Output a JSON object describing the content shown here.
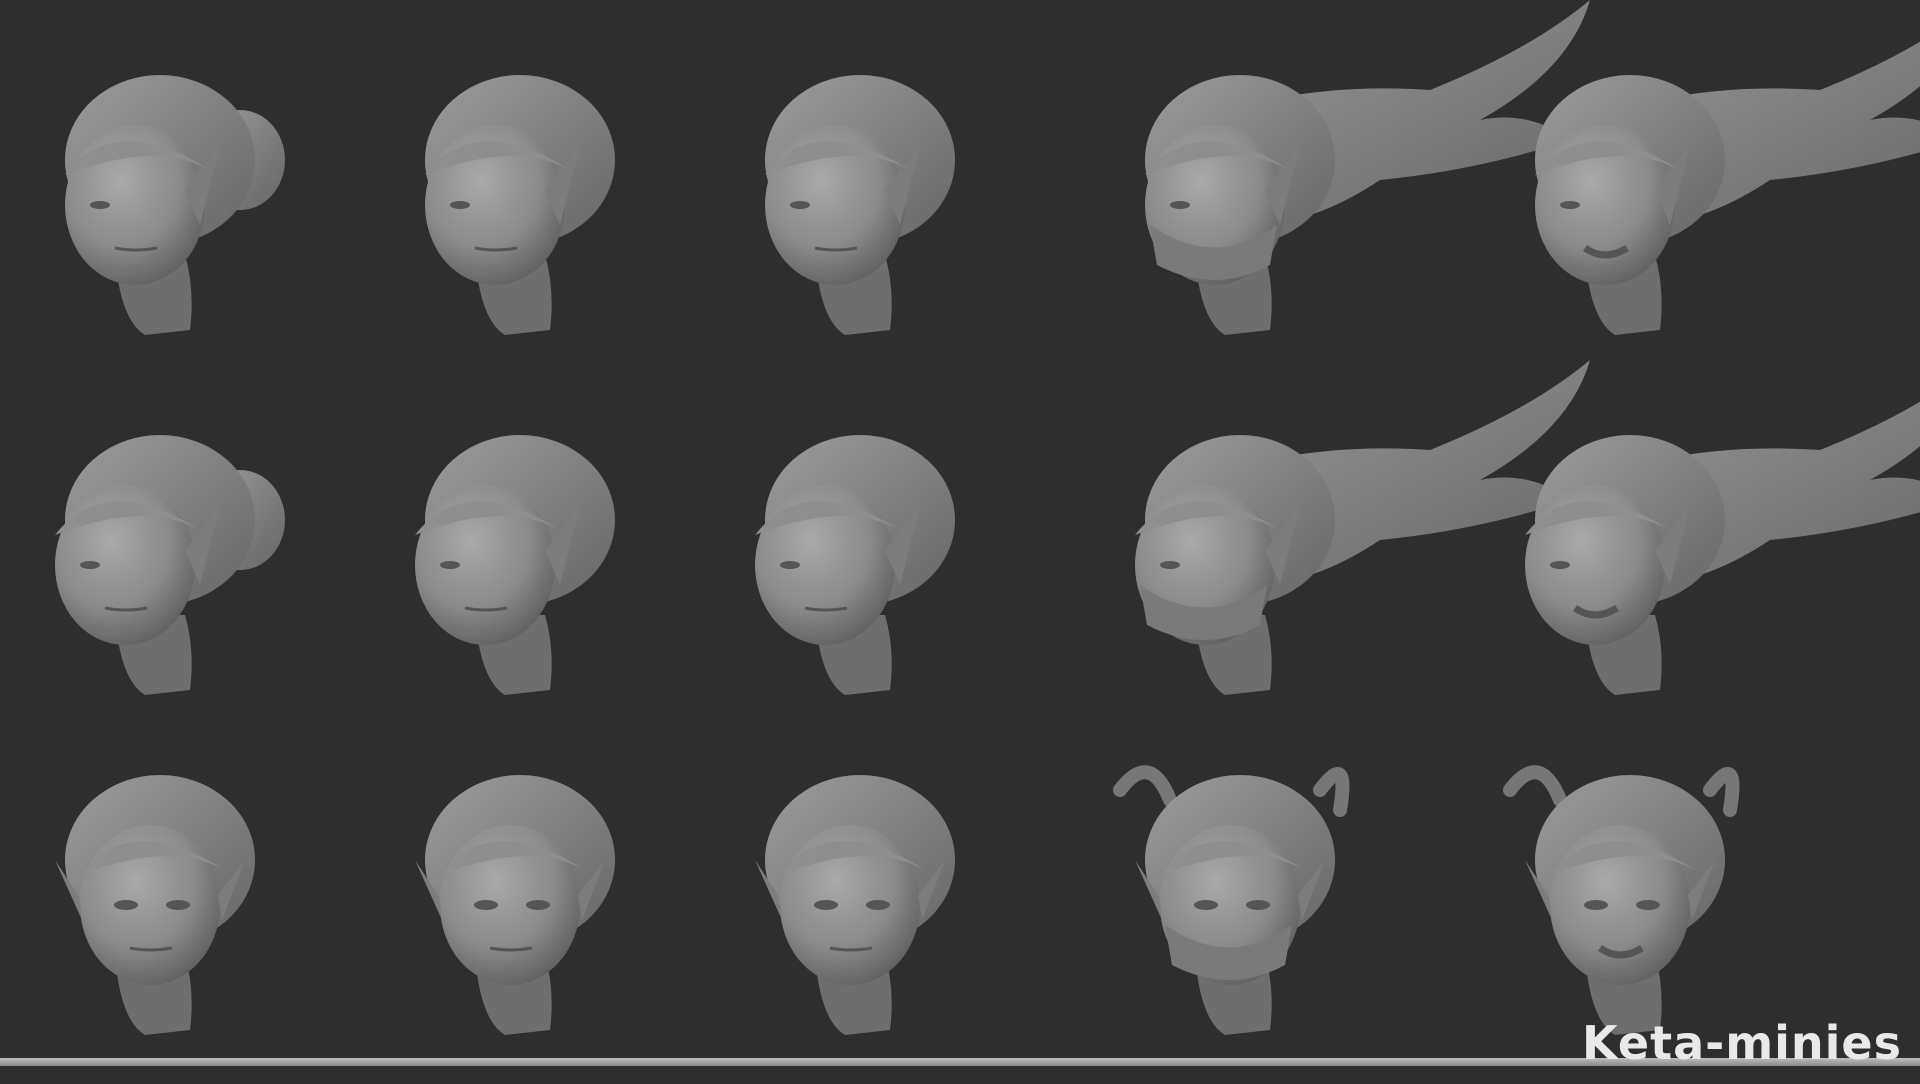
{
  "title": "",
  "brand": {
    "text": "Keta-minies"
  },
  "palette": {
    "background": "#2e2e2e",
    "sculpt_fill": "#8b8b8b",
    "sculpt_light": "#a6a6a6",
    "sculpt_dark": "#5b5b5b",
    "rule": "#a9a9a9",
    "brand_color": "#e9e9e9"
  },
  "heads": [
    {
      "id": "bun-three-quarter",
      "style": "low bun",
      "view": "three-quarter"
    },
    {
      "id": "braid-three-quarter",
      "style": "crown braid",
      "view": "three-quarter"
    },
    {
      "id": "bob-three-quarter",
      "style": "side-swept bob",
      "view": "three-quarter"
    },
    {
      "id": "windswept-masked-three-quarter",
      "style": "windswept long hair with mask",
      "view": "three-quarter"
    },
    {
      "id": "windswept-snarl-three-quarter",
      "style": "windswept long hair, snarling",
      "view": "three-quarter"
    },
    {
      "id": "bun-profile",
      "style": "low bun",
      "view": "profile"
    },
    {
      "id": "braid-profile",
      "style": "crown braid",
      "view": "profile"
    },
    {
      "id": "bob-profile",
      "style": "side-swept bob",
      "view": "profile"
    },
    {
      "id": "windswept-masked-profile",
      "style": "windswept long hair with mask",
      "view": "profile"
    },
    {
      "id": "windswept-snarl-profile",
      "style": "windswept long hair, snarling",
      "view": "profile"
    },
    {
      "id": "bun-front",
      "style": "low bun",
      "view": "front"
    },
    {
      "id": "braid-front",
      "style": "crown braid",
      "view": "front"
    },
    {
      "id": "bob-front",
      "style": "side-swept bob",
      "view": "front"
    },
    {
      "id": "windswept-masked-front",
      "style": "windswept long hair with mask",
      "view": "front"
    },
    {
      "id": "windswept-snarl-front",
      "style": "windswept long hair, snarling",
      "view": "front"
    }
  ]
}
